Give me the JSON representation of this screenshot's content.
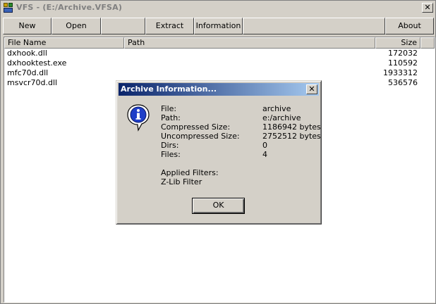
{
  "window": {
    "title": "VFS - (E:/Archive.VFSA)",
    "close_glyph": "✕"
  },
  "toolbar": {
    "new_label": "New",
    "open_label": "Open",
    "extract_label": "Extract",
    "information_label": "Information",
    "about_label": "About"
  },
  "list": {
    "columns": [
      "File Name",
      "Path",
      "Size"
    ],
    "rows": [
      {
        "name": "dxhook.dll",
        "size": "172032"
      },
      {
        "name": "dxhooktest.exe",
        "size": "110592"
      },
      {
        "name": "mfc70d.dll",
        "size": "1933312"
      },
      {
        "name": "msvcr70d.dll",
        "size": "536576"
      }
    ]
  },
  "dialog": {
    "title": "Archive Information...",
    "close_glyph": "✕",
    "icon": "info-icon",
    "fields": [
      {
        "label": "File:",
        "value": "archive"
      },
      {
        "label": "Path:",
        "value": "e:/archive"
      },
      {
        "label": "Compressed Size:",
        "value": "1186942 bytes"
      },
      {
        "label": "Uncompressed Size:",
        "value": "2752512 bytes"
      },
      {
        "label": "Dirs:",
        "value": "0"
      },
      {
        "label": "Files:",
        "value": "4"
      }
    ],
    "filters_heading": "Applied Filters:",
    "filters": [
      "Z-Lib Filter"
    ],
    "ok_label": "OK"
  }
}
